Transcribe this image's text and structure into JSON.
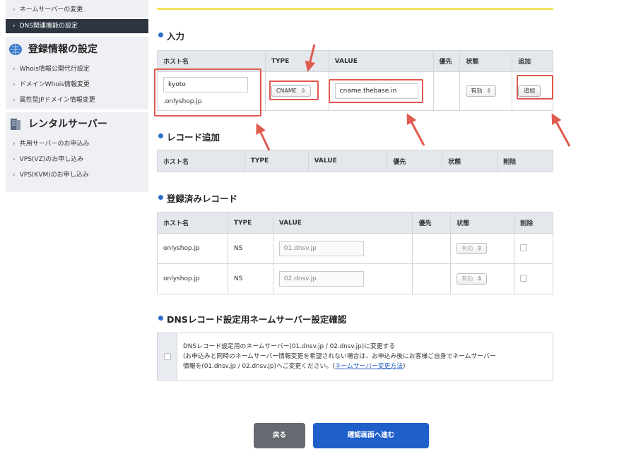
{
  "sidebar": {
    "top_items": [
      "ネームサーバーの変更",
      "DNS関連機能の設定"
    ],
    "section1": {
      "heading": "登録情報の設定",
      "icon": "globe-icon",
      "items": [
        "Whois情報公開代行設定",
        "ドメインWhois情報変更",
        "属性型JPドメイン情報変更"
      ]
    },
    "section2": {
      "heading": "レンタルサーバー",
      "icon": "server-icon",
      "items": [
        "共用サーバーのお申込み",
        "VPS(VZ)のお申し込み",
        "VPS(KVM)のお申し込み"
      ]
    }
  },
  "input_section": {
    "title": "入力",
    "headers": [
      "ホスト名",
      "TYPE",
      "VALUE",
      "優先",
      "状態",
      "追加"
    ],
    "host_value": "kyoto",
    "host_suffix": ".onlyshop.jp",
    "type_value": "CNAME",
    "value_value": "cname.thebase.in",
    "priority": "",
    "status_value": "有効",
    "add_label": "追加"
  },
  "record_add_section": {
    "title": "レコード追加",
    "headers": [
      "ホスト名",
      "TYPE",
      "VALUE",
      "優先",
      "状態",
      "削除"
    ]
  },
  "registered_section": {
    "title": "登録済みレコード",
    "headers": [
      "ホスト名",
      "TYPE",
      "VALUE",
      "優先",
      "状態",
      "削除"
    ],
    "rows": [
      {
        "host": "onlyshop.jp",
        "type": "NS",
        "value": "01.dnsv.jp",
        "status": "有効"
      },
      {
        "host": "onlyshop.jp",
        "type": "NS",
        "value": "02.dnsv.jp",
        "status": "有効"
      }
    ]
  },
  "confirm_section": {
    "title": "DNSレコード設定用ネームサーバー設定確認",
    "line1": "DNSレコード設定用のネームサーバー(01.dnsv.jp / 02.dnsv.jp)に変更する",
    "line2": "(お申込みと同時のネームサーバー情報変更を希望されない場合は、お申込み後にお客様ご自身でネームサーバー",
    "line3_pre": "情報を(01.dnsv.jp / 02.dnsv.jp)へご変更ください。(",
    "link": "ネームサーバー変更方法",
    "line3_post": ")"
  },
  "buttons": {
    "back": "戻る",
    "next": "確認画面へ進む"
  },
  "colors": {
    "accent_blue": "#1f5fc9",
    "highlight_red": "#e05a4e",
    "sidebar_active": "#2c3440",
    "top_border_yellow": "#f3e35a"
  }
}
